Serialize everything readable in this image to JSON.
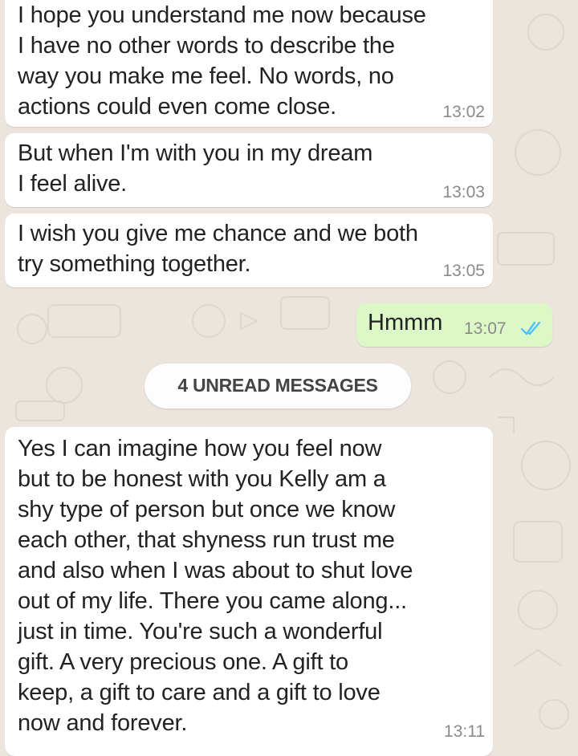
{
  "chat": {
    "messages": [
      {
        "direction": "incoming",
        "text": "I hope you understand me now because\nI have no other words to describe the\nway you make me feel. No words, no\nactions could even come close.",
        "time": "13:02"
      },
      {
        "direction": "incoming",
        "text": "But when I'm with you in my dream\nI feel alive.",
        "time": "13:03"
      },
      {
        "direction": "incoming",
        "text": "I wish you give me chance and we both\ntry something together.",
        "time": "13:05"
      },
      {
        "direction": "outgoing",
        "text": "Hmmm",
        "time": "13:07",
        "status_icon": "double-check-icon"
      },
      {
        "direction": "incoming",
        "text": "Yes I can imagine how you feel now\nbut to be honest with you Kelly am a\nshy type of person but once we know\neach other, that shyness run trust me\nand also when I was about to shut love\nout of my life. There you came along...\njust in time. You're such a wonderful\ngift. A very precious one. A gift to\nkeep, a gift to care and a gift to love\nnow and forever.",
        "time": "13:11"
      }
    ],
    "unread_divider": "4 UNREAD MESSAGES"
  },
  "colors": {
    "wallpaper": "#ece5dd",
    "incoming_bubble": "#ffffff",
    "outgoing_bubble": "#dcf8c6",
    "read_ticks": "#4fc3f7",
    "timestamp": "#8a8a8a"
  }
}
